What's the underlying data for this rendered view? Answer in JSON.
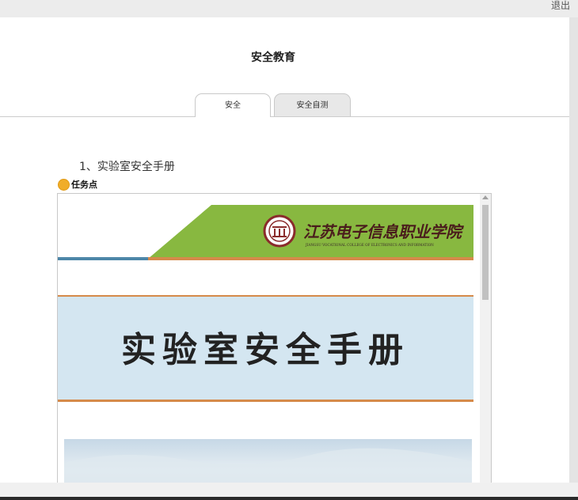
{
  "header": {
    "logout_label": "退出"
  },
  "page": {
    "title": "安全教育"
  },
  "tabs": [
    {
      "label": "安全",
      "active": true
    },
    {
      "label": "安全自测",
      "active": false
    }
  ],
  "content": {
    "section_heading": "1、实验室安全手册",
    "task_label": "任务点"
  },
  "document": {
    "college_name_calligraphy": "江苏电子信息职业学院",
    "college_name_english": "JIANGSU VOCATIONAL COLLEGE OF ELECTRONICS AND INFORMATION",
    "manual_title": "实验室安全手册"
  },
  "colors": {
    "banner_green": "#88b840",
    "title_band_blue": "#d4e6f1",
    "rule_orange": "#d58a4a",
    "rule_blue": "#4d86a8",
    "task_dot": "#f0ad2a"
  }
}
